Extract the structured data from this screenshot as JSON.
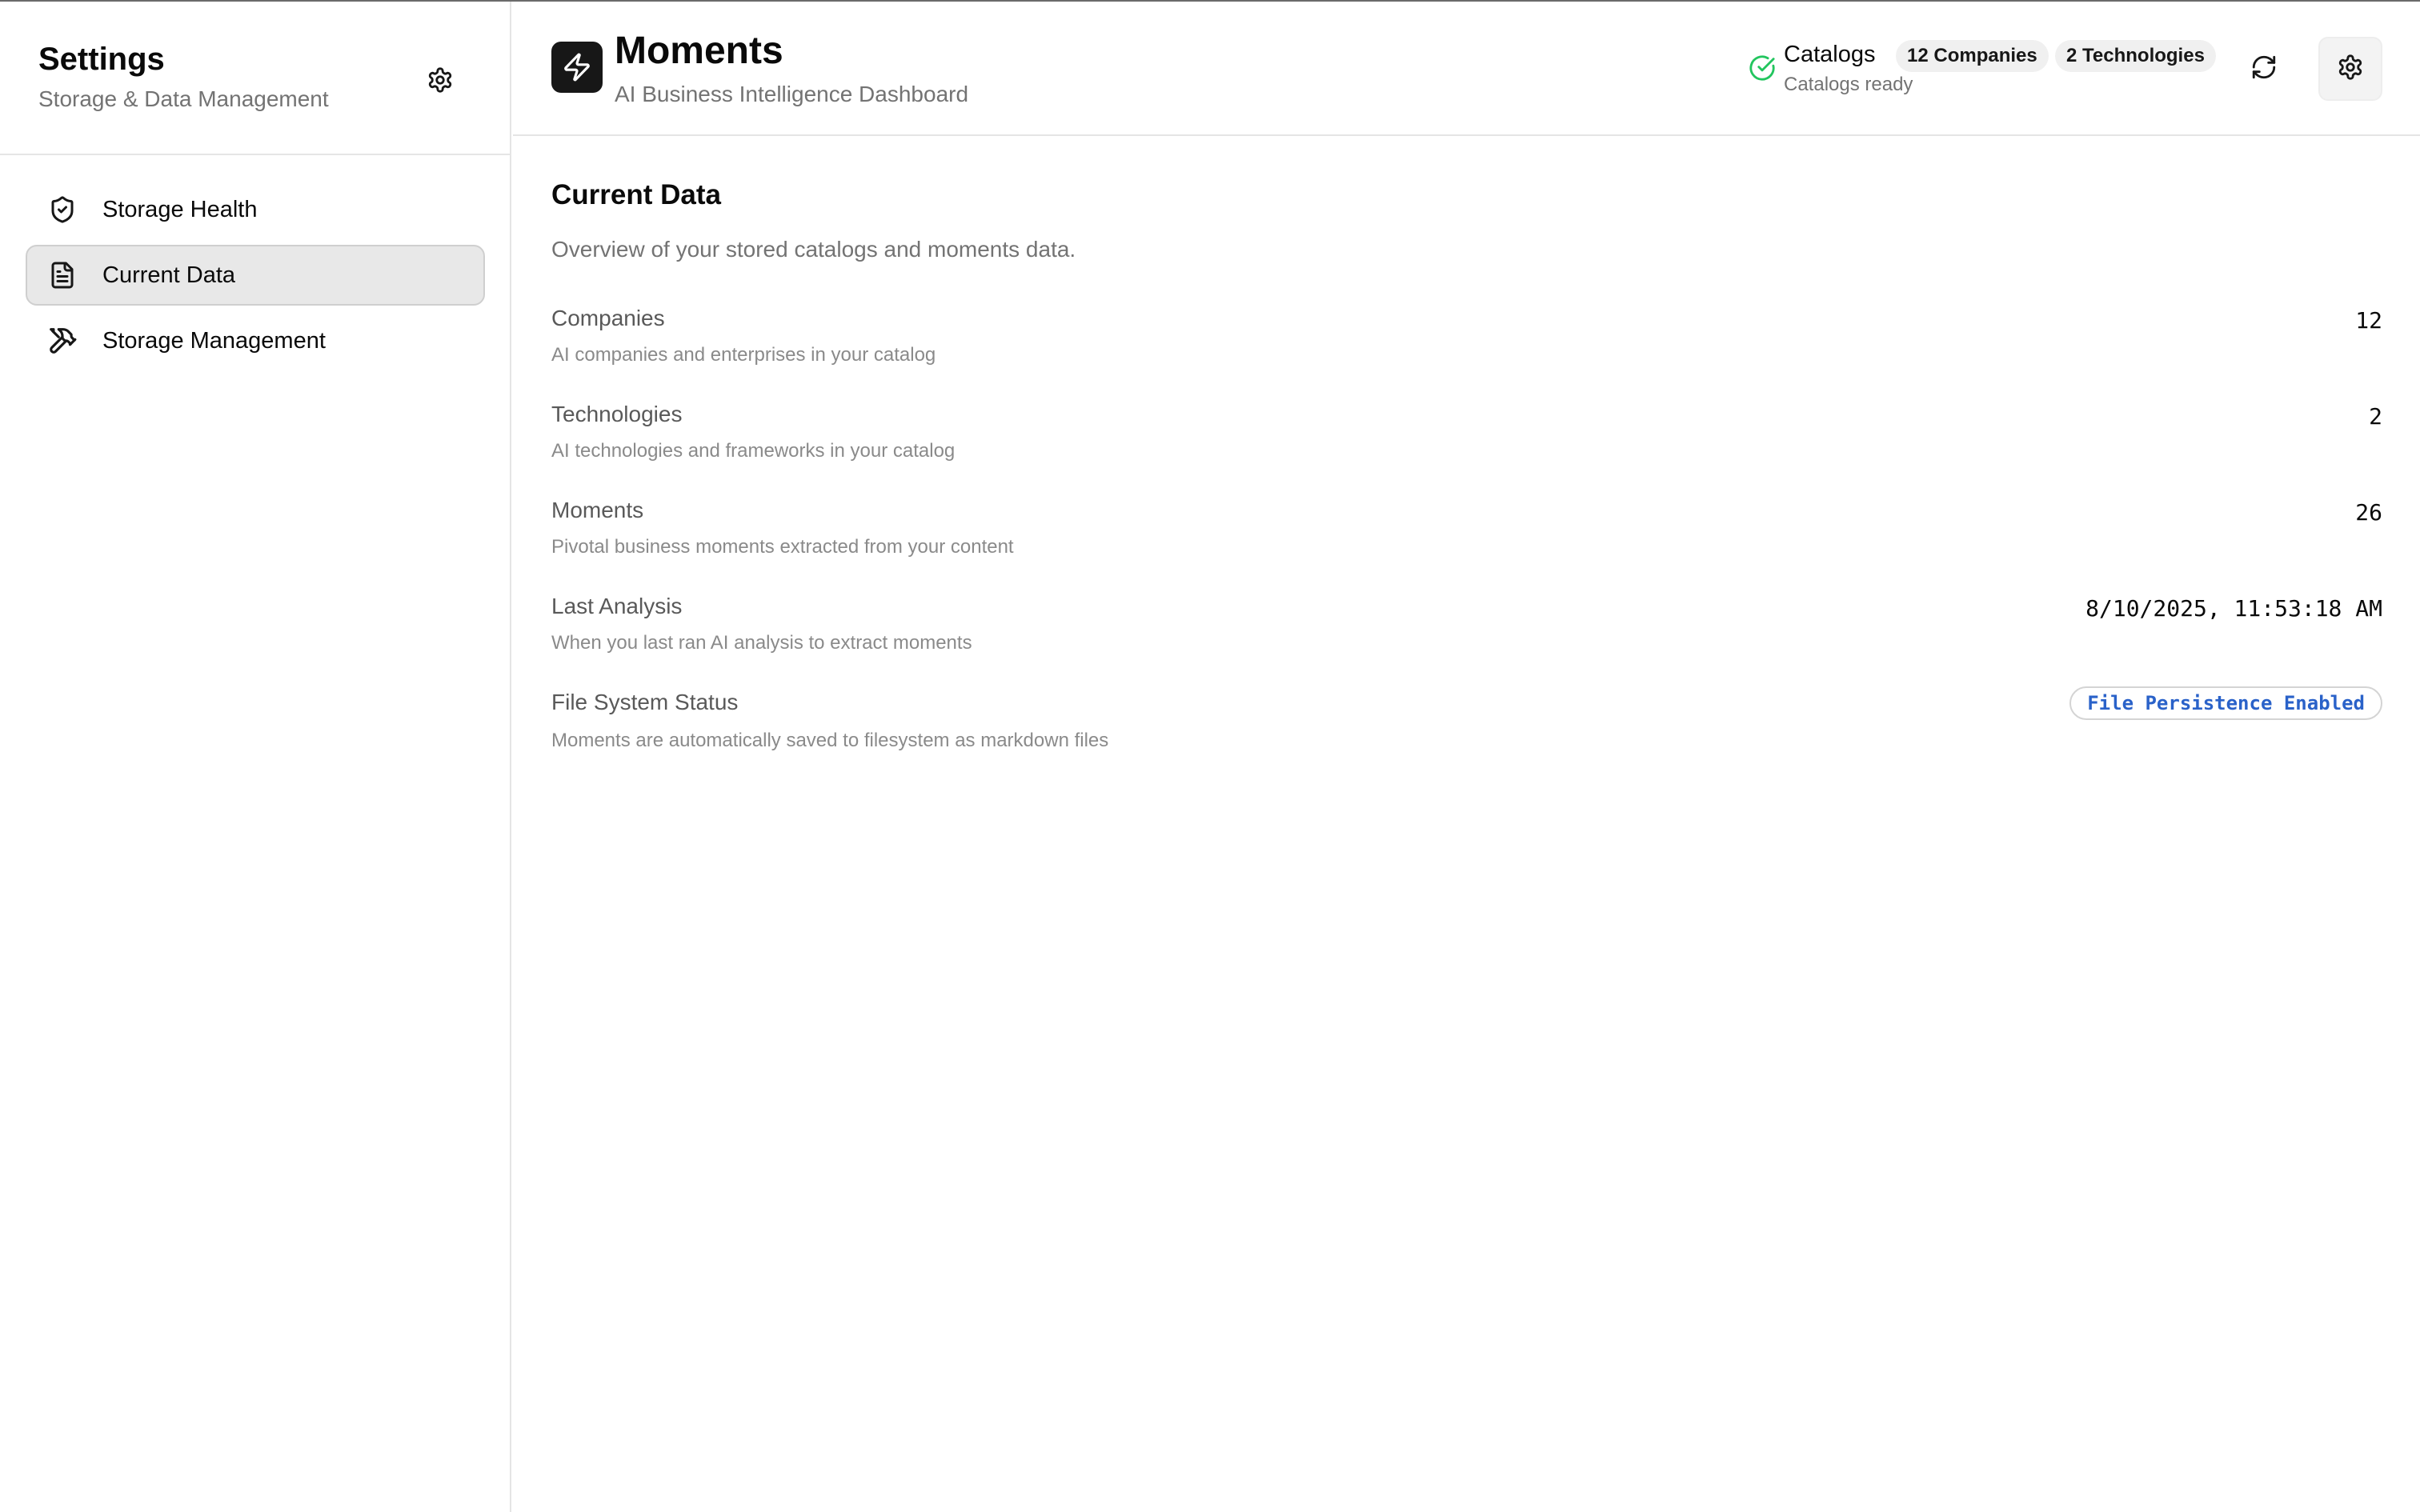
{
  "sidebar": {
    "title": "Settings",
    "subtitle": "Storage & Data Management",
    "gear_icon": "gear-icon",
    "items": [
      {
        "label": "Storage Health",
        "icon": "shield-check-icon",
        "active": false
      },
      {
        "label": "Current Data",
        "icon": "file-text-icon",
        "active": true
      },
      {
        "label": "Storage Management",
        "icon": "tools-icon",
        "active": false
      }
    ]
  },
  "header": {
    "logo_icon": "lightning-icon",
    "title": "Moments",
    "subtitle": "AI Business Intelligence Dashboard",
    "status": {
      "icon": "check-circle-icon",
      "label": "Catalogs",
      "sublabel": "Catalogs ready",
      "companies_badge": "12 Companies",
      "technologies_badge": "2 Technologies",
      "color": "#22c55e"
    },
    "refresh_icon": "refresh-icon",
    "settings_icon": "gear-icon"
  },
  "main": {
    "title": "Current Data",
    "description": "Overview of your stored catalogs and moments data.",
    "rows": [
      {
        "label": "Companies",
        "description": "AI companies and enterprises in your catalog",
        "value": "12"
      },
      {
        "label": "Technologies",
        "description": "AI technologies and frameworks in your catalog",
        "value": "2"
      },
      {
        "label": "Moments",
        "description": "Pivotal business moments extracted from your content",
        "value": "26"
      },
      {
        "label": "Last Analysis",
        "description": "When you last ran AI analysis to extract moments",
        "value": "8/10/2025, 11:53:18 AM"
      },
      {
        "label": "File System Status",
        "description": "Moments are automatically saved to filesystem as markdown files",
        "badge": "File Persistence Enabled"
      }
    ]
  },
  "colors": {
    "accent_blue": "#2a62c9",
    "active_nav_bg": "#e8e8e8",
    "logo_bg": "#171717"
  }
}
